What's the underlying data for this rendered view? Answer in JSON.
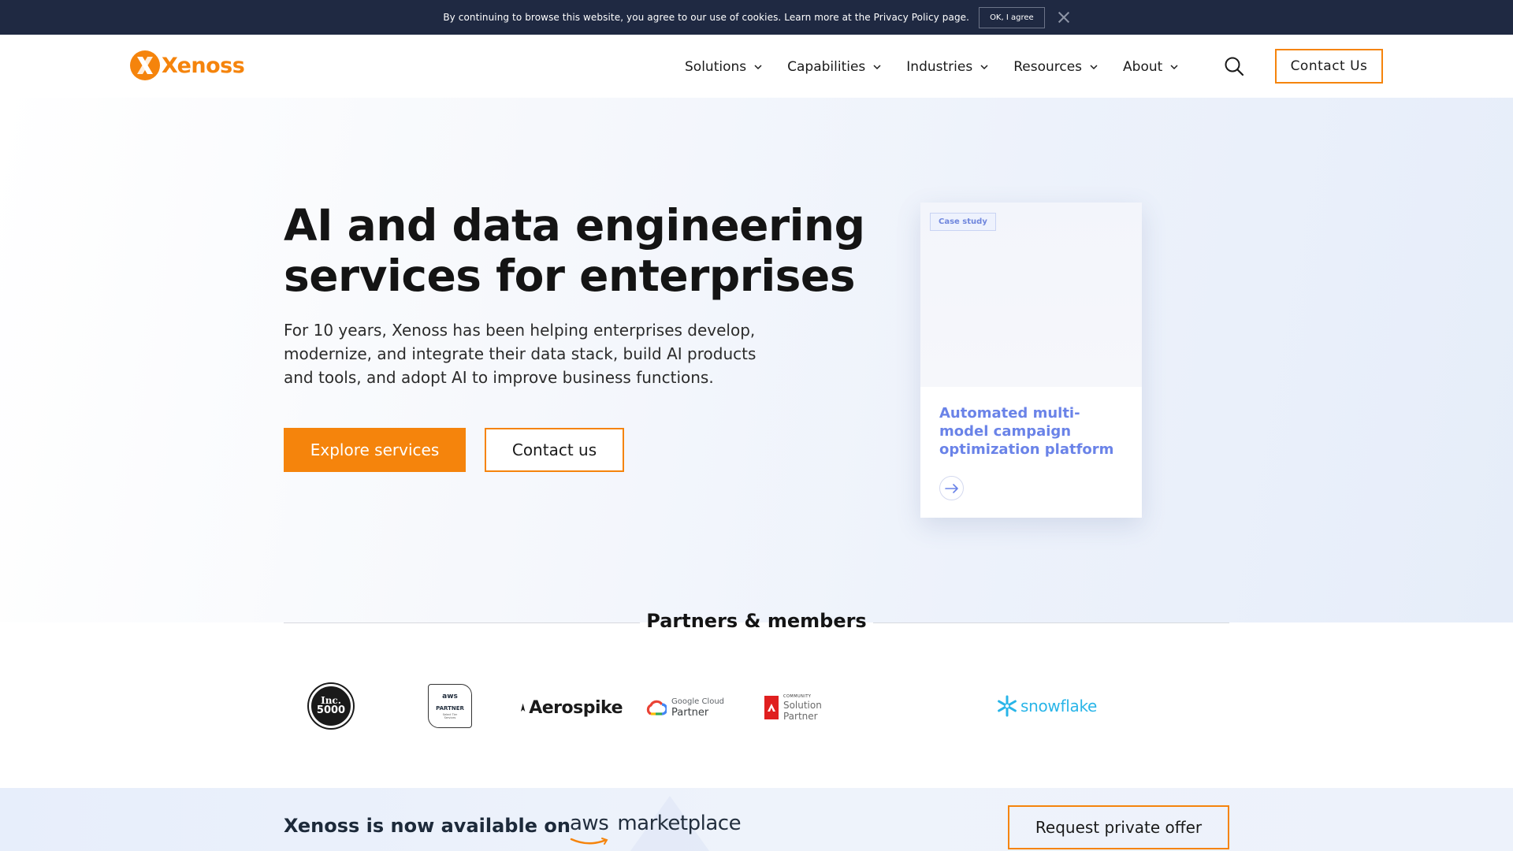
{
  "cookie": {
    "text": "By continuing to browse this website, you agree to our use of cookies. Learn more at the Privacy Policy page.",
    "ok_label": "OK, I agree"
  },
  "header": {
    "logo_text": "Xenoss",
    "nav": [
      "Solutions",
      "Capabilities",
      "Industries",
      "Resources",
      "About"
    ],
    "contact_label": "Contact Us"
  },
  "hero": {
    "title": "AI and data engineering services for enterprises",
    "subtitle": "For 10 years, Xenoss has been helping enterprises develop, modernize, and integrate their data stack, build AI products and tools, and adopt AI to improve business functions.",
    "primary_cta": "Explore services",
    "secondary_cta": "Contact us"
  },
  "case_card": {
    "badge": "Case study",
    "title": "Automated multi-model campaign optimization platform"
  },
  "partners": {
    "title": "Partners & members",
    "inc_line1": "Inc.",
    "inc_line2": "5000",
    "aws_partner_top": "aws",
    "aws_partner_mid": "PARTNER",
    "aws_partner_bottom": "Select Tier Services",
    "aerospike": "Aerospike",
    "google_line1": "Google Cloud",
    "google_line2": "Partner",
    "adobe_line1": "COMMUNITY",
    "adobe_line2": "Solution Partner",
    "snowflake": "snowflake"
  },
  "aws_banner": {
    "text": "Xenoss is now available on",
    "logo_aws": "aws",
    "logo_marketplace": "marketplace",
    "button": "Request private offer"
  },
  "colors": {
    "accent": "#f5840c",
    "cookie_bg": "#1f2942",
    "case_title": "#6a83e8",
    "snowflake": "#29b5e8"
  }
}
